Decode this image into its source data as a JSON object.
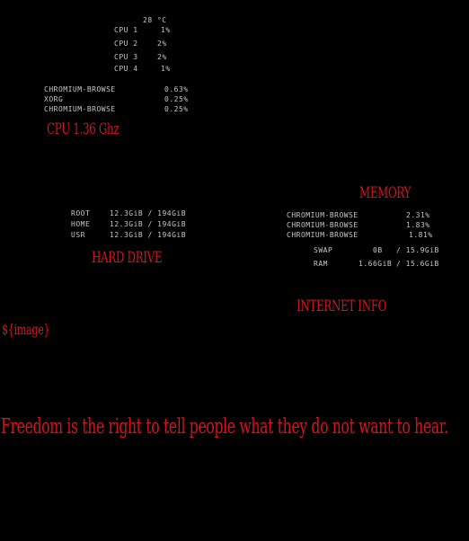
{
  "temperature": "28 °C",
  "cpu_cores": [
    {
      "label": "CPU 1",
      "value": "1%"
    },
    {
      "label": "CPU 2",
      "value": "2%"
    },
    {
      "label": "CPU 3",
      "value": "2%"
    },
    {
      "label": "CPU 4",
      "value": "1%"
    }
  ],
  "cpu_processes": [
    {
      "name": "CHROMIUM-BROWSE",
      "value": "0.63%"
    },
    {
      "name": "XORG",
      "value": "0.25%"
    },
    {
      "name": "CHROMIUM-BROWSE",
      "value": "0.25%"
    }
  ],
  "cpu_heading": "CPU  1.36 Ghz",
  "memory_heading": "MEMORY",
  "memory_processes": [
    {
      "name": "CHROMIUM-BROWSE",
      "value": "2.31%"
    },
    {
      "name": "CHROMIUM-BROWSE",
      "value": "1.83%"
    },
    {
      "name": "CHROMIUM-BROWSE",
      "value": "1.81%"
    }
  ],
  "memory_usage": [
    {
      "label": "SWAP",
      "used": "0B",
      "total": "/ 15.9GiB"
    },
    {
      "label": "RAM",
      "used": "1.66GiB",
      "total": "/ 15.6GiB"
    }
  ],
  "drives": [
    {
      "label": "ROOT",
      "usage": "12.3GiB / 194GiB"
    },
    {
      "label": "HOME",
      "usage": "12.3GiB / 194GiB"
    },
    {
      "label": "USR",
      "usage": "12.3GiB / 194GiB"
    }
  ],
  "hard_drive_heading": "HARD DRIVE",
  "internet_heading": "INTERNET INFO",
  "image_placeholder": "${image}",
  "quote": "Freedom is the right to tell people what they do not want to hear."
}
